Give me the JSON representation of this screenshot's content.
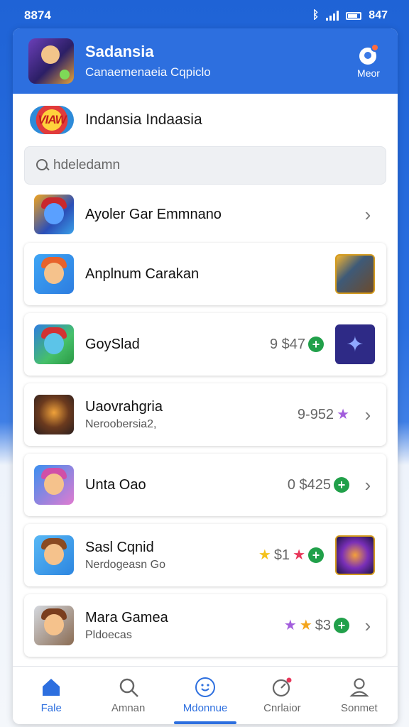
{
  "status_bar": {
    "time": "8874",
    "battery": "847"
  },
  "header": {
    "title": "Sadansia",
    "subtitle": "Canaemenaeia Cqpiclo",
    "more_label": "Meor"
  },
  "brand": {
    "logo_text": "VIAW",
    "name": "Indansia Indaasia"
  },
  "search": {
    "placeholder": "hdeledamn"
  },
  "items": [
    {
      "title": "Ayoler Gar Emmnano",
      "subtitle": "",
      "meta": ""
    },
    {
      "title": "Anplnum Carakan",
      "subtitle": "",
      "meta": ""
    },
    {
      "title": "GoySlad",
      "subtitle": "",
      "meta": "9 $47"
    },
    {
      "title": "Uaovrahgria",
      "subtitle": "Neroobersia2,",
      "meta": "9-952"
    },
    {
      "title": "Unta Oao",
      "subtitle": "",
      "meta": "0 $425"
    },
    {
      "title": "Sasl Cqnid",
      "subtitle": "Nerdogeasn Go",
      "meta": "$1"
    },
    {
      "title": "Mara Gamea",
      "subtitle": "Pldoecas",
      "meta": "$3"
    }
  ],
  "nav": [
    {
      "label": "Fale",
      "icon": "home-icon"
    },
    {
      "label": "Amnan",
      "icon": "search-icon"
    },
    {
      "label": "Mdonnue",
      "icon": "compass-icon"
    },
    {
      "label": "Cnrlaior",
      "icon": "gauge-icon"
    },
    {
      "label": "Sonmet",
      "icon": "profile-icon"
    }
  ],
  "colors": {
    "brand_blue": "#2d6fdf",
    "plus_green": "#21a04a",
    "star_yellow": "#f4c21c",
    "star_purple": "#a25ddc",
    "star_red": "#e8375a"
  }
}
